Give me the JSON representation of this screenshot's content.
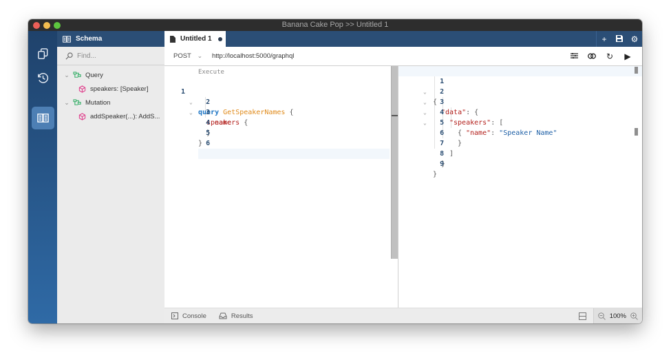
{
  "window": {
    "title": "Banana Cake Pop >> Untitled 1"
  },
  "activity_bar": {
    "items": [
      {
        "name": "documents",
        "icon": "copy-icon",
        "active": false
      },
      {
        "name": "history",
        "icon": "history-icon",
        "active": false
      },
      {
        "name": "schema",
        "icon": "book-icon",
        "active": true
      }
    ]
  },
  "sidebar": {
    "title": "Schema",
    "find_placeholder": "Find...",
    "tree": [
      {
        "label": "Query",
        "type": "root",
        "expanded": true
      },
      {
        "label": "speakers: [Speaker]",
        "type": "field"
      },
      {
        "label": "Mutation",
        "type": "root",
        "expanded": true
      },
      {
        "label": "addSpeaker(...): AddS...",
        "type": "field"
      }
    ]
  },
  "tabs": [
    {
      "label": "Untitled 1",
      "unsaved": true
    }
  ],
  "tab_actions": [
    "plus-icon",
    "save-icon",
    "gear-icon"
  ],
  "request": {
    "method": "POST",
    "url": "http://localhost:5000/graphql",
    "actions": [
      "settings-icon",
      "subscription-icon",
      "refresh-icon",
      "run-icon"
    ]
  },
  "editor": {
    "codelens": "Execute",
    "lines": [
      {
        "n": "1",
        "text": "query GetSpeakerNames {"
      },
      {
        "n": "2",
        "text": "speakers {"
      },
      {
        "n": "3",
        "text": "name"
      },
      {
        "n": "4",
        "text": "}"
      },
      {
        "n": "5",
        "text": "}"
      },
      {
        "n": "6",
        "text": ""
      }
    ],
    "tokens": {
      "kw": "query",
      "op": "GetSpeakerNames",
      "brace_open": "{",
      "speakers": "speakers",
      "name": "name",
      "brace_close": "}"
    }
  },
  "result": {
    "line_numbers": [
      "1",
      "2",
      "3",
      "4",
      "5",
      "6",
      "7",
      "8",
      "9"
    ],
    "tokens": {
      "open": "{",
      "data_key": "\"data\"",
      "speakers_key": "\"speakers\"",
      "arr_open": "[",
      "name_key": "\"name\"",
      "name_val": "\"Speaker Name\"",
      "close": "}",
      "arr_close": "]",
      "colon": ": "
    }
  },
  "statusbar": {
    "console": "Console",
    "results": "Results",
    "zoom": "100%"
  }
}
